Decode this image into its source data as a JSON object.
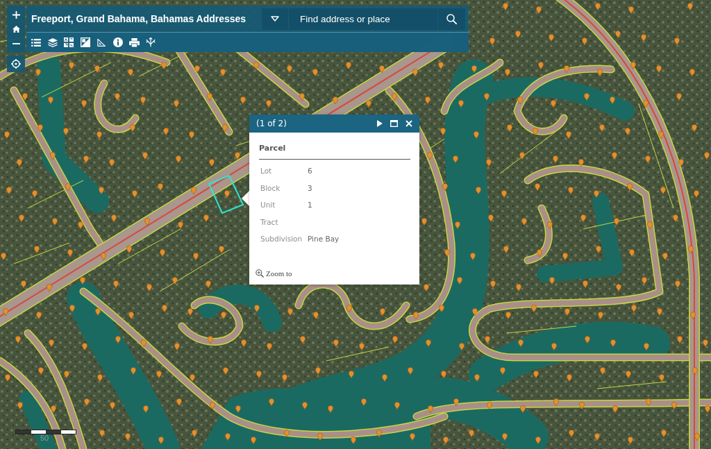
{
  "header": {
    "title": "Freeport, Grand Bahama, Bahamas Addresses",
    "search": {
      "placeholder": "Find address or place"
    }
  },
  "popup": {
    "pager": "(1 of 2)",
    "title": "Parcel",
    "fields": [
      {
        "label": "Lot",
        "value": "6"
      },
      {
        "label": "Block",
        "value": "3"
      },
      {
        "label": "Unit",
        "value": "1"
      },
      {
        "label": "Tract"
      },
      {
        "label": "Subdivision",
        "value": "Pine Bay"
      }
    ],
    "link": "Zoom to"
  },
  "scale_bar": {
    "label": "50"
  }
}
